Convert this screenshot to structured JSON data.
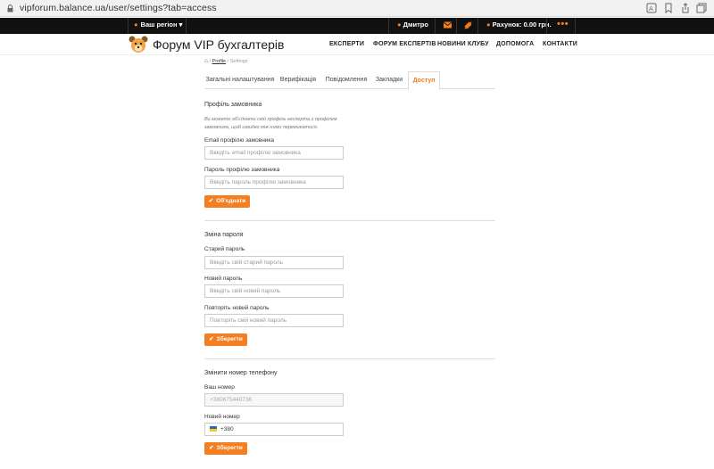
{
  "browser": {
    "url": "vipforum.balance.ua/user/settings?tab=access"
  },
  "topbar": {
    "region_label": "Ваш регіон",
    "user_name": "Дмитро",
    "account_label": "Рахунок: 0.00 грн.",
    "more": "•••"
  },
  "header": {
    "brand": "Форум VIP бухгалтерів",
    "nav": [
      "ЕКСПЕРТИ",
      "ФОРУМ ЕКСПЕРТІВ",
      "НОВИНИ КЛУБУ",
      "ДОПОМОГА",
      "КОНТАКТИ"
    ]
  },
  "breadcrumb": {
    "profile": "Profile",
    "separator": "/",
    "current": "Settings"
  },
  "tabs": [
    "Загальні налаштування",
    "Верифікація",
    "Повідомлення",
    "Закладки",
    "Доступ"
  ],
  "active_tab": "Доступ",
  "customer_profile": {
    "title": "Профіль замовника",
    "note": "Ви можете об'єднати свій профіль експерта з профілем замовника, щоб швидко між ними перемикатися.",
    "email_label": "Email профілю замовника",
    "email_placeholder": "Введіть email профілю замовника",
    "password_label": "Пароль профілю замовника",
    "password_placeholder": "Введіть пароль профілю замовника",
    "button": "Об'єднати"
  },
  "change_password": {
    "title": "Зміна пароля",
    "old_label": "Старий пароль",
    "old_placeholder": "Введіть свій старий пароль",
    "new_label": "Новий пароль",
    "new_placeholder": "Введіть свій новий пароль",
    "repeat_label": "Повторіть новий пароль",
    "repeat_placeholder": "Повторіть свій новий пароль",
    "button": "Зберегти"
  },
  "change_phone": {
    "title": "Змінити номер телефону",
    "current_label": "Ваш номер",
    "current_value": "+380675440736",
    "new_label": "Новий номер",
    "new_value": "+380",
    "button": "Зберегти"
  },
  "colors": {
    "accent": "#f47e20",
    "topbar": "#111111"
  }
}
